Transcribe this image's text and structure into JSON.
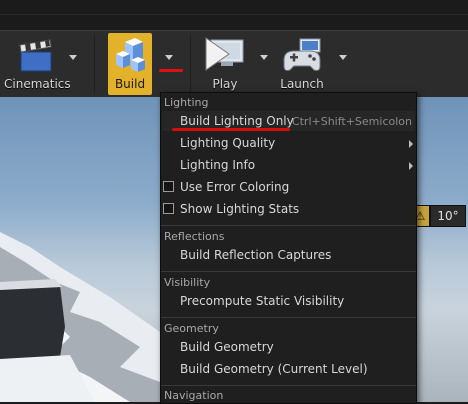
{
  "toolbar": {
    "cinematics_label": "Cinematics",
    "build_label": "Build",
    "play_label": "Play",
    "launch_label": "Launch"
  },
  "viewport": {
    "angle_value": "10°"
  },
  "menu": {
    "section_lighting": "Lighting",
    "build_lighting_only": "Build Lighting Only",
    "build_lighting_only_shortcut": "Ctrl+Shift+Semicolon",
    "lighting_quality": "Lighting Quality",
    "lighting_info": "Lighting Info",
    "use_error_coloring": "Use Error Coloring",
    "show_lighting_stats": "Show Lighting Stats",
    "section_reflections": "Reflections",
    "build_reflection_captures": "Build Reflection Captures",
    "section_visibility": "Visibility",
    "precompute_static_visibility": "Precompute Static Visibility",
    "section_geometry": "Geometry",
    "build_geometry": "Build Geometry",
    "build_geometry_current_level": "Build Geometry (Current Level)",
    "section_navigation": "Navigation"
  },
  "colors": {
    "build_accent": "#e4b12b",
    "annotation_red": "#e01010"
  }
}
